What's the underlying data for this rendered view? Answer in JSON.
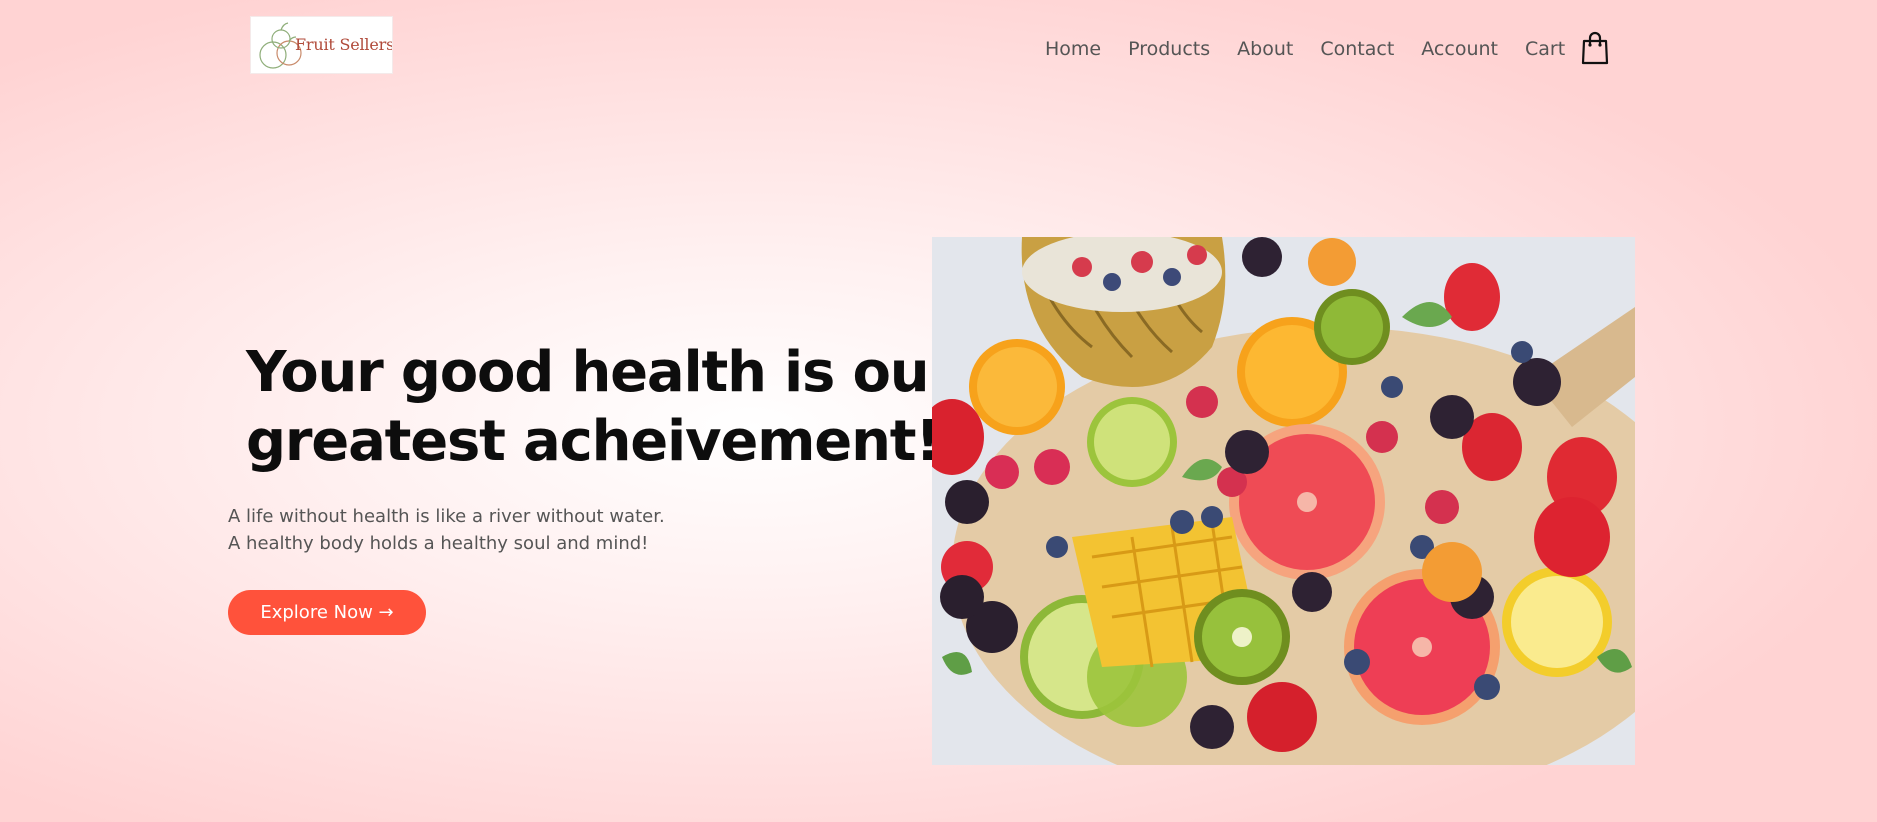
{
  "brand": {
    "logo_text": "Fruit Sellers",
    "logo_alt": "fruit-sellers-logo"
  },
  "nav": {
    "items": [
      {
        "label": "Home"
      },
      {
        "label": "Products"
      },
      {
        "label": "About"
      },
      {
        "label": "Contact"
      },
      {
        "label": "Account"
      },
      {
        "label": "Cart"
      }
    ],
    "cart_icon": "shopping-bag-icon"
  },
  "hero": {
    "headline_line1": "Your good health is our",
    "headline_line2": "greatest acheivement!",
    "subtext_line1": "A life without health is like a river without water.",
    "subtext_line2": "A healthy body holds a healthy soul and mind!",
    "cta_label": "Explore Now →",
    "image_alt": "fruit-platter-image"
  },
  "colors": {
    "accent": "#ff523b",
    "nav_text": "#555555",
    "headline": "#0d0d0d",
    "background": "#ffe1e1"
  }
}
